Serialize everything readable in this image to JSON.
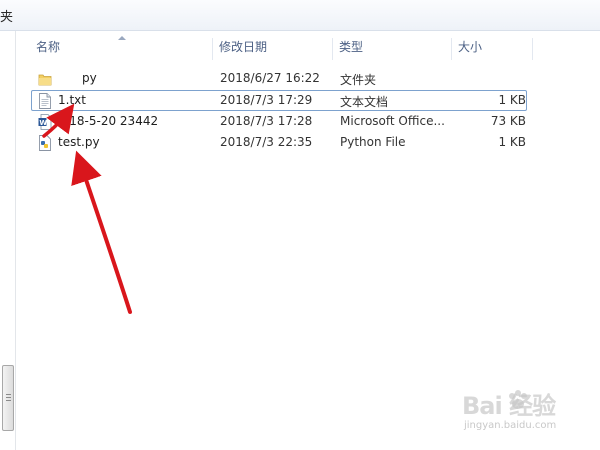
{
  "breadcrumb": {
    "tail": "夹"
  },
  "columns": {
    "name": "名称",
    "date": "修改日期",
    "type": "类型",
    "size": "大小"
  },
  "files": [
    {
      "name": "py",
      "date": "2018/6/27 16:22",
      "type": "文件夹",
      "size": "",
      "icon": "folder-icon"
    },
    {
      "name": "1.txt",
      "date": "2018/7/3 17:29",
      "type": "文本文档",
      "size": "1 KB",
      "icon": "text-file-icon"
    },
    {
      "name": "2018-5-20 23442",
      "date": "2018/7/3 17:28",
      "type": "Microsoft Office...",
      "size": "73 KB",
      "icon": "word-file-icon"
    },
    {
      "name": "test.py",
      "date": "2018/7/3 22:35",
      "type": "Python File",
      "size": "1 KB",
      "icon": "python-file-icon"
    }
  ],
  "watermark": {
    "logo": "Bai 经验",
    "sub": "jingyan.baidu.com"
  },
  "colors": {
    "header_text": "#4d6185",
    "arrow": "#d9161c",
    "focus_border": "#7da2ce"
  }
}
